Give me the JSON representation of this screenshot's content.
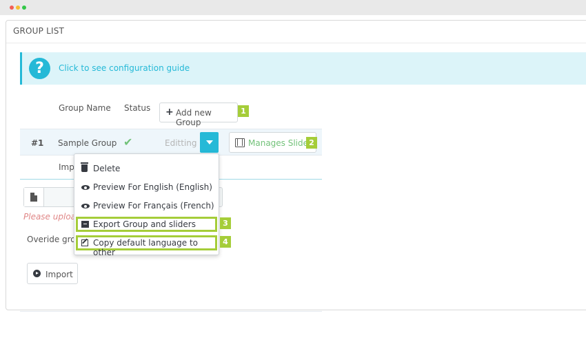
{
  "panel": {
    "title": "GROUP LIST"
  },
  "info": {
    "icon": "question-icon",
    "icon_glyph": "?",
    "link_text": "Click to see configuration guide"
  },
  "table": {
    "headers": {
      "name": "Group Name",
      "status": "Status"
    },
    "add_button_label": "Add new Group"
  },
  "row": {
    "num": "#1",
    "name": "Sample Group",
    "status_glyph": "✔",
    "edit_label": "Editting",
    "manage_label": "Manages Slider"
  },
  "import": {
    "label": "Imp",
    "warning": "Please uploa",
    "override_label": "Overide gro",
    "button_label": "Import"
  },
  "menu": {
    "items": [
      {
        "label": "Delete",
        "icon": "trash-icon"
      },
      {
        "label": "Preview For English (English)",
        "icon": "eye-icon"
      },
      {
        "label": "Preview For Français (French)",
        "icon": "eye-icon"
      },
      {
        "label": "Export Group and sliders",
        "icon": "archive-icon"
      },
      {
        "label": "Copy default language to other",
        "icon": "edit-icon"
      }
    ]
  },
  "badges": [
    "1",
    "2",
    "3",
    "4"
  ],
  "colors": {
    "accent": "#25b9d7",
    "badge": "#a5cd39",
    "success": "#72c279",
    "info_bg": "#dcf4f9"
  }
}
